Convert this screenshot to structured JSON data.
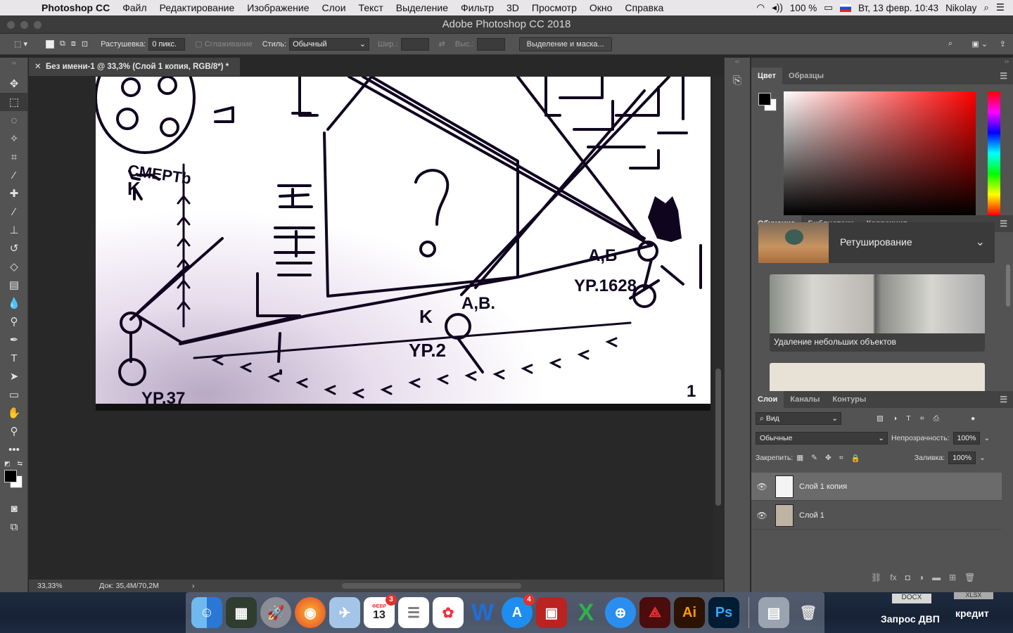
{
  "menubar": {
    "app": "Photoshop CC",
    "items": [
      "Файл",
      "Редактирование",
      "Изображение",
      "Слои",
      "Текст",
      "Выделение",
      "Фильтр",
      "3D",
      "Просмотр",
      "Окно",
      "Справка"
    ],
    "battery": "100 %",
    "datetime": "Вт, 13 февр.  10:43",
    "user": "Nikolay"
  },
  "window": {
    "title": "Adobe Photoshop CC 2018"
  },
  "options": {
    "feather_label": "Растушевка:",
    "feather_value": "0 пикс.",
    "antialias_label": "Сглаживание",
    "style_label": "Стиль:",
    "style_value": "Обычный",
    "width_label": "Шир.:",
    "height_label": "Выс.:",
    "mask_button": "Выделение и маска..."
  },
  "document": {
    "tab_title": "Без имени-1 @ 33,3% (Слой 1 копия, RGB/8*) *",
    "zoom": "33,33%",
    "doc_info": "Док: 35,4M/70,2M"
  },
  "color_panel": {
    "tabs": [
      "Цвет",
      "Образцы"
    ]
  },
  "learn_panel": {
    "tabs": [
      "Обучение",
      "Библиотеки",
      "Коррекция"
    ],
    "topic": "Ретуширование",
    "card_caption": "Удаление небольших объектов"
  },
  "layers_panel": {
    "tabs": [
      "Слои",
      "Каналы",
      "Контуры"
    ],
    "filter_label": "Вид",
    "blend_mode": "Обычные",
    "opacity_label": "Непрозрачность:",
    "opacity_value": "100%",
    "lock_label": "Закрепить:",
    "fill_label": "Заливка:",
    "fill_value": "100%",
    "layers": [
      {
        "name": "Слой 1 копия",
        "selected": true
      },
      {
        "name": "Слой 1",
        "selected": false
      }
    ]
  },
  "dock": {
    "calendar_month": "ФЕВР",
    "calendar_day": "13",
    "calendar_badge": "3",
    "appstore_badge": "4",
    "ai_label": "Ai",
    "ps_label": "Ps",
    "desktop_items": [
      "Запрос ДВП",
      "кредит"
    ],
    "file_tags": [
      "DOCX",
      "XLSX"
    ]
  },
  "colors": {
    "accent": "#1473e6",
    "panel": "#535353",
    "dark": "#282828"
  }
}
